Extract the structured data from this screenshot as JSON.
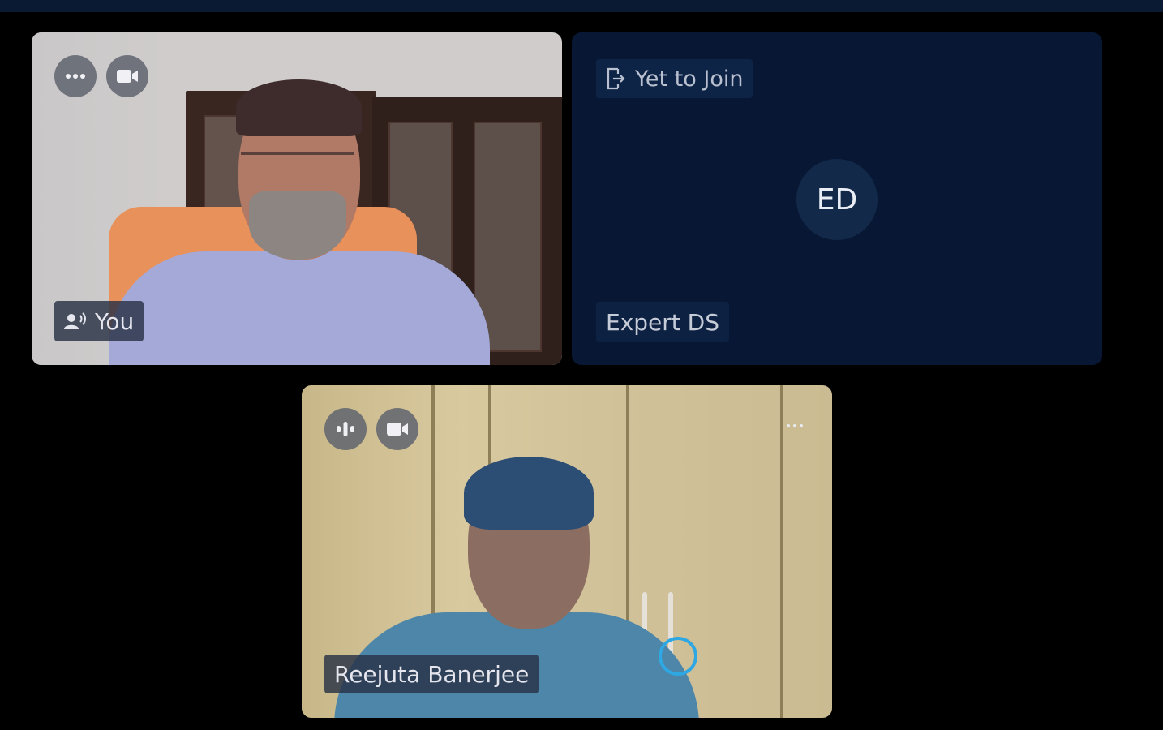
{
  "participants": [
    {
      "name": "You",
      "role": "self",
      "audio_state": "speaking",
      "video": "on",
      "controls": [
        "more-options",
        "camera"
      ]
    },
    {
      "name": "Expert DS",
      "initials": "ED",
      "status": "Yet to Join",
      "video": "off"
    },
    {
      "name": "Reejuta Banerjee",
      "audio_state": "talking",
      "video": "on",
      "controls": [
        "audio-activity",
        "camera",
        "more-options"
      ]
    }
  ],
  "colors": {
    "page_bg": "#000000",
    "top_bar": "#0b1a33",
    "tile_off_bg": "#081834",
    "avatar_bg": "#13294a"
  }
}
